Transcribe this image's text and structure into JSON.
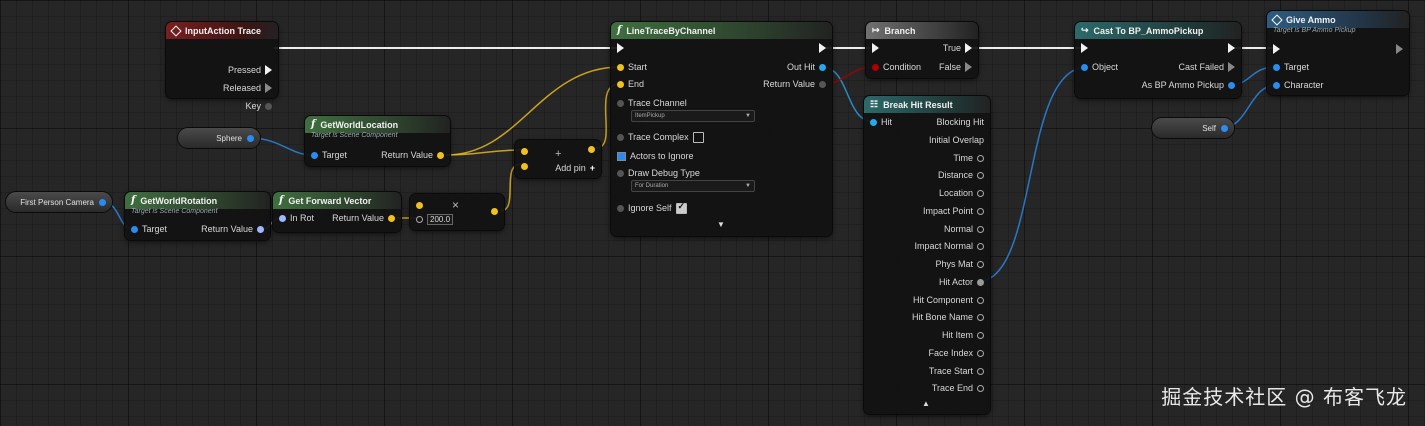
{
  "colors": {
    "background": "#262626",
    "exec": "#f2f2f2",
    "object_pin": "#2a8cf0",
    "vector_pin": "#f0c020",
    "rotator_pin": "#9fb7ff",
    "float_pin": "#a0e060"
  },
  "input_action": {
    "title": "InputAction Trace",
    "pins": [
      "Pressed",
      "Released",
      "Key"
    ]
  },
  "sphere_var": {
    "label": "Sphere"
  },
  "camera_var": {
    "label": "First Person Camera"
  },
  "get_world_location": {
    "title": "GetWorldLocation",
    "subtitle": "Target is Scene Component",
    "target": "Target",
    "return": "Return Value"
  },
  "get_world_rotation": {
    "title": "GetWorldRotation",
    "subtitle": "Target is Scene Component",
    "target": "Target",
    "return": "Return Value"
  },
  "get_forward_vector": {
    "title": "Get Forward Vector",
    "in_rot": "In Rot",
    "return": "Return Value"
  },
  "multiply": {
    "symbol": "×",
    "value": "200.0"
  },
  "add": {
    "symbol": "+",
    "add_pin": "Add pin"
  },
  "line_trace": {
    "title": "LineTraceByChannel",
    "start": "Start",
    "end": "End",
    "out_hit": "Out Hit",
    "return": "Return Value",
    "trace_channel_label": "Trace Channel",
    "trace_channel_value": "ItemPickup",
    "trace_complex": "Trace Complex",
    "actors_to_ignore": "Actors to Ignore",
    "draw_debug_label": "Draw Debug Type",
    "draw_debug_value": "For Duration",
    "ignore_self": "Ignore Self"
  },
  "branch": {
    "title": "Branch",
    "condition": "Condition",
    "true_label": "True",
    "false_label": "False"
  },
  "break_hit": {
    "title": "Break Hit Result",
    "hit": "Hit",
    "outputs": [
      "Blocking Hit",
      "Initial Overlap",
      "Time",
      "Distance",
      "Location",
      "Impact Point",
      "Normal",
      "Impact Normal",
      "Phys Mat",
      "Hit Actor",
      "Hit Component",
      "Hit Bone Name",
      "Hit Item",
      "Face Index",
      "Trace Start",
      "Trace End"
    ]
  },
  "cast": {
    "title": "Cast To BP_AmmoPickup",
    "object": "Object",
    "cast_failed": "Cast Failed",
    "as_pickup": "As BP Ammo Pickup"
  },
  "give_ammo": {
    "title": "Give Ammo",
    "subtitle": "Target is BP Ammo Pickup",
    "target": "Target",
    "character": "Character"
  },
  "self_var": {
    "label": "Self"
  },
  "watermark": "掘金技术社区 @ 布客飞龙"
}
